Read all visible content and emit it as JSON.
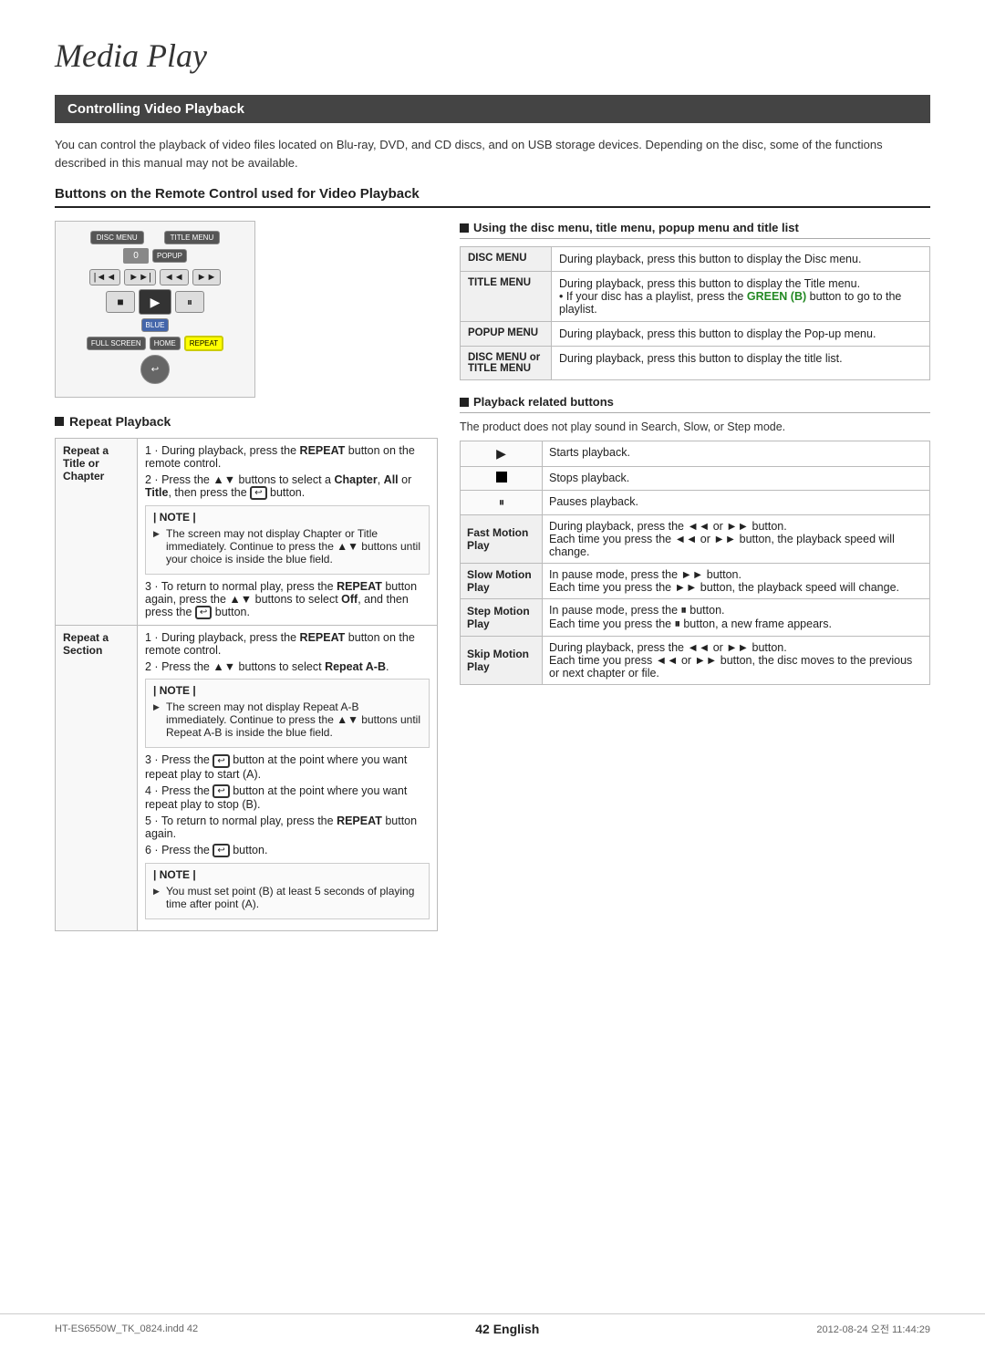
{
  "page": {
    "title": "Media Play",
    "footer_left": "HT-ES6550W_TK_0824.indd   42",
    "footer_right": "2012-08-24   오전 11:44:29",
    "page_number": "42",
    "page_lang": "English"
  },
  "section": {
    "header": "Controlling Video Playback",
    "intro": "You can control the playback of video files located on Blu-ray, DVD, and CD discs, and on USB storage devices. Depending on the disc, some of the functions described in this manual may not be available.",
    "subsection_title": "Buttons on the Remote Control used for Video Playback"
  },
  "repeat_playback": {
    "title": "Repeat Playback",
    "repeat_title_label": "Repeat a Title or Chapter",
    "repeat_title_steps": [
      "During playback, press the REPEAT button on the remote control.",
      "Press the ▲▼ buttons to select a Chapter, All or Title, then press the  button.",
      "| NOTE |",
      "The screen may not display Chapter or Title immediately. Continue to press the ▲▼ buttons until your choice is inside the blue field.",
      "To return to normal play, press the REPEAT button again, press the ▲▼ buttons to select Off, and then press the  button."
    ],
    "repeat_section_label": "Repeat a Section",
    "repeat_section_steps": [
      "During playback, press the REPEAT button on the remote control.",
      "Press the ▲▼ buttons to select Repeat A-B.",
      "| NOTE |",
      "The screen may not display Repeat A-B immediately. Continue to press the ▲▼ buttons until  Repeat A-B  is inside the blue field.",
      "Press the  button at the point where you want repeat play to start (A).",
      "Press the  button at the point where you want repeat play to stop (B).",
      "To return to normal play, press the REPEAT button again.",
      "Press the  button.",
      "| NOTE |",
      "You must set point (B) at least 5 seconds of playing time after point (A)."
    ]
  },
  "disc_menu": {
    "title": "Using the disc menu, title menu, popup menu and title list",
    "rows": [
      {
        "label": "DISC MENU",
        "desc": "During playback, press this button to display the Disc menu."
      },
      {
        "label": "TITLE MENU",
        "desc": "During playback, press this button to display the Title menu.\n• If your disc has a playlist, press the GREEN (B) button to go to the playlist."
      },
      {
        "label": "POPUP MENU",
        "desc": "During playback, press this button to display the Pop-up menu."
      },
      {
        "label": "DISC MENU or TITLE MENU",
        "desc": "During playback, press this button to display the title list."
      }
    ]
  },
  "playback_buttons": {
    "title": "Playback related buttons",
    "product_note": "The product does not play sound in Search, Slow, or Step mode.",
    "rows": [
      {
        "icon": "▶",
        "label": "",
        "desc": "Starts playback."
      },
      {
        "icon": "■",
        "label": "",
        "desc": "Stops playback."
      },
      {
        "icon": "⏸",
        "label": "",
        "desc": "Pauses playback."
      },
      {
        "icon": "",
        "label": "Fast Motion Play",
        "desc": "During playback, press the ◄◄ or ►► button.\nEach time you press the ◄◄ or ►► button, the playback speed will change."
      },
      {
        "icon": "",
        "label": "Slow Motion Play",
        "desc": "In pause mode, press the ►► button.\nEach time you press the ►► button, the playback speed will change."
      },
      {
        "icon": "",
        "label": "Step Motion Play",
        "desc": "In pause mode, press the ⏸ button.\nEach time you press the ⏸ button, a new frame appears."
      },
      {
        "icon": "",
        "label": "Skip Motion Play",
        "desc": "During playback, press the ◄◄ or ►► button.\nEach time you press ◄◄ or ►► button, the disc moves to the previous or next chapter or file."
      }
    ]
  }
}
